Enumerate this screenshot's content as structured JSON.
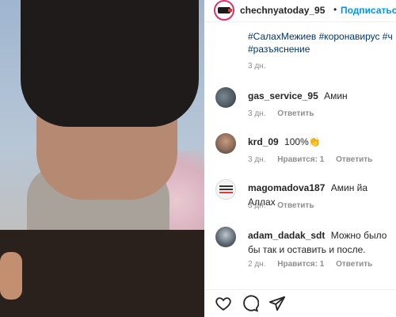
{
  "post": {
    "username": "chechnyatoday_95",
    "separator": "•",
    "follow_label": "Подписаться",
    "caption_lines": [
      "#СалахМежиев #коронавирус #ч",
      "#разъяснение"
    ],
    "caption_time": "3 дн."
  },
  "comments": [
    {
      "username": "gas_service_95",
      "text": "Амин",
      "time": "3 дн.",
      "likes": "",
      "reply": "Ответить"
    },
    {
      "username": "krd_09",
      "text": "100%👏",
      "time": "3 дн.",
      "likes": "Нравится: 1",
      "reply": "Ответить"
    },
    {
      "username": "magomadova187",
      "text": "Амин йа Аллах",
      "time": "3 дн.",
      "likes": "",
      "reply": "Ответить"
    },
    {
      "username": "adam_dadak_sdt",
      "text": "Можно было бы так и оставить и после.",
      "time": "2 дн.",
      "likes": "Нравится: 1",
      "reply": "Ответить"
    }
  ],
  "icons": {
    "like": "heart-icon",
    "comment": "comment-icon",
    "share": "share-icon"
  }
}
